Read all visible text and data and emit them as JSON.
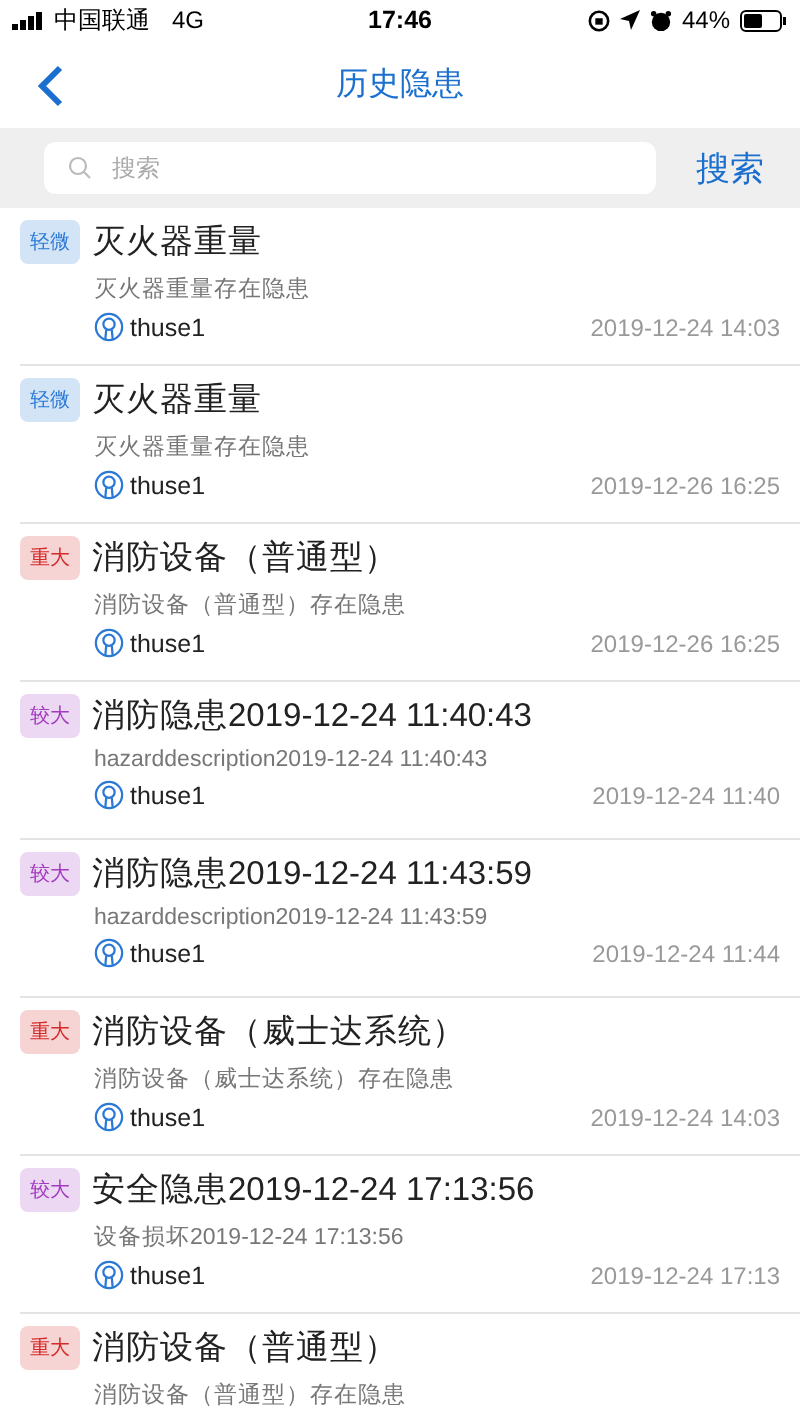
{
  "status_bar": {
    "carrier": "中国联通",
    "network": "4G",
    "time": "17:46",
    "battery": "44%"
  },
  "nav": {
    "title": "历史隐患"
  },
  "search": {
    "placeholder": "搜索",
    "button": "搜索"
  },
  "items": [
    {
      "color": "#2a79d6",
      "tag": "轻微",
      "title": "灭火器重量",
      "description": "灭火器重量存在隐患",
      "user": "thuse1",
      "time": "2019-12-24 14:03"
    },
    {
      "color": "#2a79d6",
      "tag": "轻微",
      "title": "灭火器重量",
      "description": "灭火器重量存在隐患",
      "user": "thuse1",
      "time": "2019-12-26 16:25"
    },
    {
      "color": "#d42a2a",
      "tag": "重大",
      "title": "消防设备（普通型）",
      "description": "消防设备（普通型）存在隐患",
      "user": "thuse1",
      "time": "2019-12-26 16:25"
    },
    {
      "color": "#a23bc0",
      "tag": "较大",
      "title": "消防隐患2019-12-24 11:40:43",
      "description": "hazarddescription2019-12-24 11:40:43",
      "user": "thuse1",
      "time": "2019-12-24 11:40"
    },
    {
      "color": "#a23bc0",
      "tag": "较大",
      "title": "消防隐患2019-12-24 11:43:59",
      "description": "hazarddescription2019-12-24 11:43:59",
      "user": "thuse1",
      "time": "2019-12-24 11:44"
    },
    {
      "color": "#d42a2a",
      "tag": "重大",
      "title": "消防设备（威士达系统）",
      "description": "消防设备（威士达系统）存在隐患",
      "user": "thuse1",
      "time": "2019-12-24 14:03"
    },
    {
      "color": "#a23bc0",
      "tag": "较大",
      "title": "安全隐患2019-12-24 17:13:56",
      "description": "设备损坏2019-12-24 17:13:56",
      "user": "thuse1",
      "time": "2019-12-24 17:13"
    },
    {
      "color": "#d42a2a",
      "tag": "重大",
      "title": "消防设备（普通型）",
      "description": "消防设备（普通型）存在隐患"
    }
  ]
}
